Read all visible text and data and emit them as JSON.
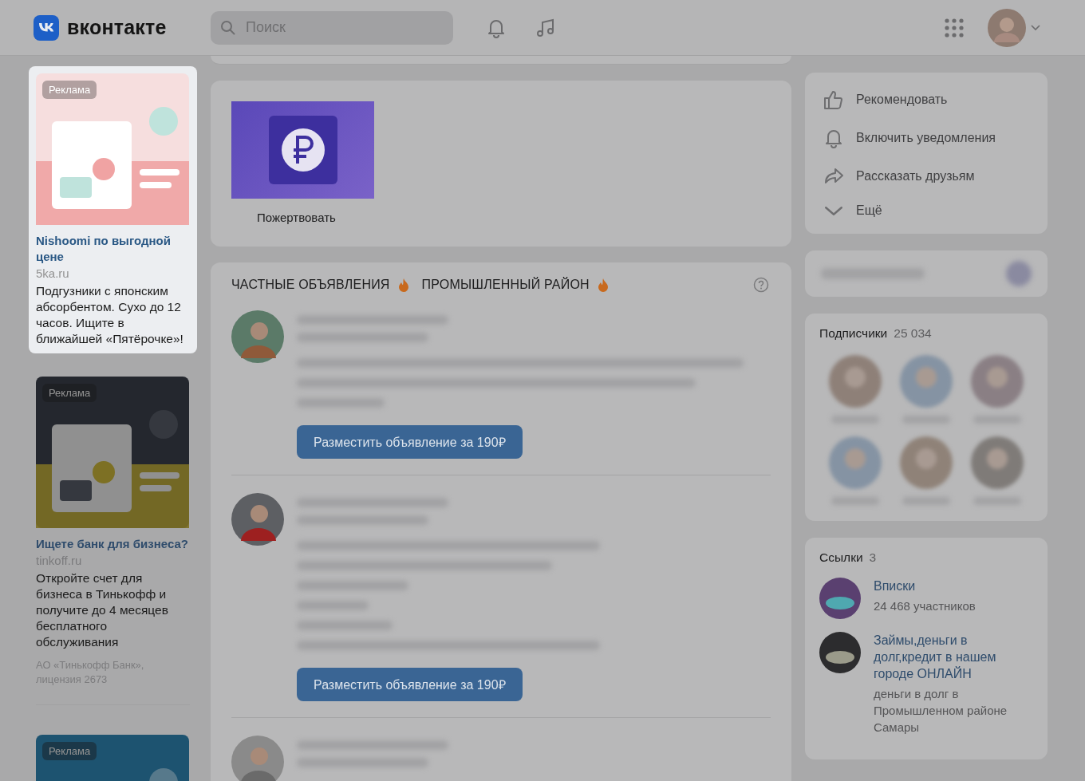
{
  "header": {
    "logo_text": "вконтакте",
    "search": {
      "placeholder": "Поиск"
    }
  },
  "ads": [
    {
      "badge": "Реклама",
      "title": "Nishoomi по выгодной цене",
      "domain": "5ka.ru",
      "text": "Подгузники с японским абсорбентом. Сухо до 12 часов. Ищите в ближайшей «Пятёрочке»!",
      "highlighted": true,
      "kind": "pink"
    },
    {
      "badge": "Реклама",
      "title": "Ищете банк для бизнеса?",
      "domain": "tinkoff.ru",
      "text": "Откройте счет для бизнеса в Тинькофф и получите до 4 месяцев бесплатного обслуживания",
      "legal": "АО «Тинькофф Банк», лицензия 2673",
      "highlighted": false,
      "kind": "dark"
    },
    {
      "badge": "Реклама",
      "highlighted": false,
      "kind": "blue"
    }
  ],
  "donate": {
    "label": "Пожертвовать"
  },
  "classifieds": {
    "title_parts": [
      "ЧАСТНЫЕ ОБЪЯВЛЕНИЯ",
      "ПРОМЫШЛЕННЫЙ РАЙОН"
    ],
    "posts": [
      {
        "button": "Разместить объявление за 190₽",
        "kind": "short"
      },
      {
        "button": "Разместить объявление за 190₽",
        "kind": "long"
      },
      {
        "kind": "cut"
      }
    ]
  },
  "actions": [
    {
      "label": "Рекомендовать",
      "kind": "like"
    },
    {
      "label": "Включить уведомления",
      "kind": "bell"
    },
    {
      "label": "Рассказать друзьям",
      "kind": "share"
    },
    {
      "label": "Ещё",
      "kind": "more"
    }
  ],
  "followers": {
    "title": "Подписчики",
    "count": "25 034"
  },
  "links": {
    "title": "Ссылки",
    "count": "3",
    "items": [
      {
        "title": "Вписки",
        "subtitle": "24 468 участников"
      },
      {
        "title": "Займы,деньги в долг,кредит в нашем городе ОНЛАЙН",
        "subtitle": "деньги в долг в Промышленном районе Самары"
      }
    ]
  }
}
